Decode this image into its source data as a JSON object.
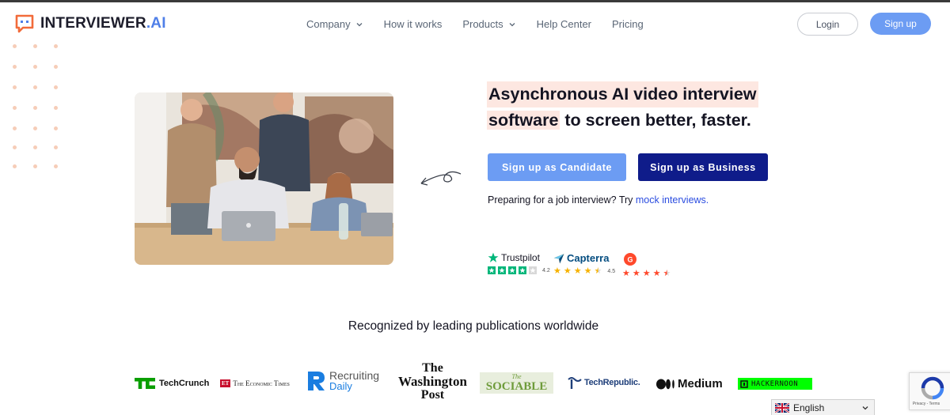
{
  "header": {
    "logo_main": "INTERVIEWER",
    "logo_suffix": ".AI",
    "nav": [
      {
        "label": "Company",
        "has_dropdown": true
      },
      {
        "label": "How it works",
        "has_dropdown": false
      },
      {
        "label": "Products",
        "has_dropdown": true
      },
      {
        "label": "Help Center",
        "has_dropdown": false
      },
      {
        "label": "Pricing",
        "has_dropdown": false
      }
    ],
    "login_label": "Login",
    "signup_label": "Sign up"
  },
  "hero": {
    "headline_line1": "Asynchronous AI video interview",
    "headline_line2_highlight": "software",
    "headline_line2_rest": " to screen better, faster.",
    "cta_candidate": "Sign up as Candidate",
    "cta_business": "Sign up as Business",
    "prep_text": "Preparing for a job interview? Try ",
    "prep_link": "mock interviews."
  },
  "ratings": [
    {
      "name": "Trustpilot",
      "score": "4.2",
      "stars": 4
    },
    {
      "name": "Capterra",
      "score": "4.5",
      "stars": 4.5
    },
    {
      "name": "G2",
      "score": "",
      "stars": 4.5
    }
  ],
  "publications": {
    "heading": "Recognized by leading publications worldwide",
    "items": [
      "TechCrunch",
      "The Economic Times",
      "Recruiting",
      "Daily",
      "The",
      "Washington",
      "Post",
      "The",
      "SOCIABLE",
      "TechRepublic.",
      "Medium",
      "HACKERNOON"
    ]
  },
  "recaptcha": {
    "links": "Privacy - Terms"
  },
  "language": {
    "selected": "English"
  },
  "colors": {
    "accent": "#6c9cf3",
    "navy": "#0f1c8a",
    "highlight": "#fde7e1",
    "logo_orange": "#f26b3a",
    "link": "#2b4de0"
  }
}
